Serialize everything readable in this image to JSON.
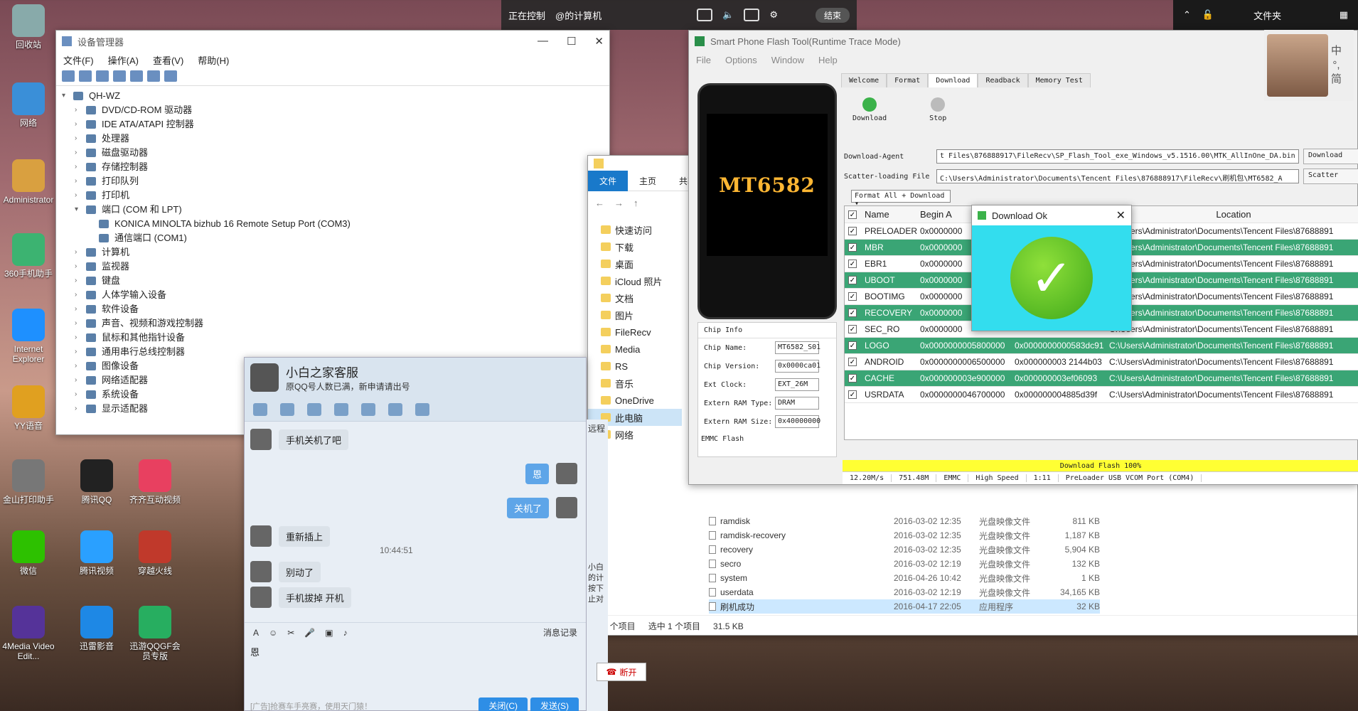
{
  "desktop": {
    "icons": [
      {
        "label": "回收站",
        "color": "#8aa"
      },
      {
        "label": "网络",
        "color": "#3a8fd8"
      },
      {
        "label": "Administrator",
        "color": "#d9a040"
      },
      {
        "label": "360手机助手",
        "color": "#3cb371"
      },
      {
        "label": "Internet Explorer",
        "color": "#1e90ff"
      },
      {
        "label": "YY语音",
        "color": "#e0a020"
      },
      {
        "label": "金山打印助手",
        "color": "#777"
      },
      {
        "label": "微信",
        "color": "#2dc100"
      },
      {
        "label": "4Media Video Edit...",
        "color": "#553399"
      },
      {
        "label": "腾讯QQ",
        "color": "#222"
      },
      {
        "label": "腾讯视频",
        "color": "#2aa0ff"
      },
      {
        "label": "迅雷影音",
        "color": "#1e88e5"
      },
      {
        "label": "齐齐互动视频",
        "color": "#e84060"
      },
      {
        "label": "穿越火线",
        "color": "#c0392b"
      },
      {
        "label": "迅游QQGF会员专版",
        "color": "#27ae60"
      }
    ]
  },
  "remote_bar": {
    "status": "正在控制",
    "target": "@的计算机",
    "end_label": "结束"
  },
  "topright": {
    "folder_label": "文件夹"
  },
  "devmgr": {
    "title": "设备管理器",
    "menu": [
      "文件(F)",
      "操作(A)",
      "查看(V)",
      "帮助(H)"
    ],
    "root": "QH-WZ",
    "nodes": [
      {
        "label": "DVD/CD-ROM 驱动器",
        "indent": 1,
        "expanded": false
      },
      {
        "label": "IDE ATA/ATAPI 控制器",
        "indent": 1,
        "expanded": false
      },
      {
        "label": "处理器",
        "indent": 1,
        "expanded": false
      },
      {
        "label": "磁盘驱动器",
        "indent": 1,
        "expanded": false
      },
      {
        "label": "存储控制器",
        "indent": 1,
        "expanded": false
      },
      {
        "label": "打印队列",
        "indent": 1,
        "expanded": false
      },
      {
        "label": "打印机",
        "indent": 1,
        "expanded": false
      },
      {
        "label": "端口 (COM 和 LPT)",
        "indent": 1,
        "expanded": true
      },
      {
        "label": "KONICA MINOLTA bizhub 16 Remote Setup Port (COM3)",
        "indent": 2,
        "expanded": null
      },
      {
        "label": "通信端口 (COM1)",
        "indent": 2,
        "expanded": null
      },
      {
        "label": "计算机",
        "indent": 1,
        "expanded": false
      },
      {
        "label": "监视器",
        "indent": 1,
        "expanded": false
      },
      {
        "label": "键盘",
        "indent": 1,
        "expanded": false
      },
      {
        "label": "人体学输入设备",
        "indent": 1,
        "expanded": false
      },
      {
        "label": "软件设备",
        "indent": 1,
        "expanded": false
      },
      {
        "label": "声音、视频和游戏控制器",
        "indent": 1,
        "expanded": false
      },
      {
        "label": "鼠标和其他指针设备",
        "indent": 1,
        "expanded": false
      },
      {
        "label": "通用串行总线控制器",
        "indent": 1,
        "expanded": false
      },
      {
        "label": "图像设备",
        "indent": 1,
        "expanded": false
      },
      {
        "label": "网络适配器",
        "indent": 1,
        "expanded": false
      },
      {
        "label": "系统设备",
        "indent": 1,
        "expanded": false
      },
      {
        "label": "显示适配器",
        "indent": 1,
        "expanded": false
      }
    ]
  },
  "qq": {
    "name": "小白之家客服",
    "signature": "原QQ号人数已满，新申请请出号",
    "messages": [
      {
        "dir": "in",
        "text": "手机关机了吧"
      },
      {
        "dir": "out",
        "text": "恩"
      },
      {
        "dir": "out",
        "text": "关机了"
      },
      {
        "dir": "in",
        "text": "重新插上"
      },
      {
        "dir": "in",
        "text": "别动了"
      },
      {
        "dir": "in",
        "text": "手机拔掉 开机"
      }
    ],
    "time": "10:44:51",
    "history_label": "消息记录",
    "input_text": "恩",
    "ad_text": "[广告]抢赛车手亮赛，使用天门猿！",
    "close_label": "关闭(C)",
    "send_label": "发送(S)",
    "side_label": "远程",
    "side_text": "小白的计按下止对",
    "hangup_label": "断开"
  },
  "explorer": {
    "ribbon_tabs": [
      "文件",
      "主页",
      "共享"
    ],
    "sidebar": [
      {
        "label": "快速访问",
        "sel": false
      },
      {
        "label": "下载",
        "sel": false
      },
      {
        "label": "桌面",
        "sel": false
      },
      {
        "label": "iCloud 照片",
        "sel": false
      },
      {
        "label": "文档",
        "sel": false
      },
      {
        "label": "图片",
        "sel": false
      },
      {
        "label": "FileRecv",
        "sel": false
      },
      {
        "label": "Media",
        "sel": false
      },
      {
        "label": "RS",
        "sel": false
      },
      {
        "label": "音乐",
        "sel": false
      },
      {
        "label": "OneDrive",
        "sel": false
      },
      {
        "label": "此电脑",
        "sel": true
      },
      {
        "label": "网络",
        "sel": false
      }
    ],
    "files": [
      {
        "name": "ramdisk",
        "date": "2016-03-02 12:35",
        "type": "光盘映像文件",
        "size": "811 KB",
        "sel": false
      },
      {
        "name": "ramdisk-recovery",
        "date": "2016-03-02 12:35",
        "type": "光盘映像文件",
        "size": "1,187 KB",
        "sel": false
      },
      {
        "name": "recovery",
        "date": "2016-03-02 12:35",
        "type": "光盘映像文件",
        "size": "5,904 KB",
        "sel": false
      },
      {
        "name": "secro",
        "date": "2016-03-02 12:19",
        "type": "光盘映像文件",
        "size": "132 KB",
        "sel": false
      },
      {
        "name": "system",
        "date": "2016-04-26 10:42",
        "type": "光盘映像文件",
        "size": "1 KB",
        "sel": false
      },
      {
        "name": "userdata",
        "date": "2016-03-02 12:19",
        "type": "光盘映像文件",
        "size": "34,165 KB",
        "sel": false
      },
      {
        "name": "刷机成功",
        "date": "2016-04-17 22:05",
        "type": "应用程序",
        "size": "32 KB",
        "sel": true
      }
    ],
    "status_count": "27 个项目",
    "status_sel": "选中 1 个项目",
    "status_size": "31.5 KB"
  },
  "flash": {
    "title": "Smart Phone Flash Tool(Runtime Trace Mode)",
    "menu": [
      "File",
      "Options",
      "Window",
      "Help"
    ],
    "model": "MT6582",
    "tabs": [
      "Welcome",
      "Format",
      "Download",
      "Readback",
      "Memory Test"
    ],
    "active_tab": "Download",
    "download_label": "Download",
    "stop_label": "Stop",
    "da_label": "Download-Agent",
    "da_value": "t Files\\876888917\\FileRecv\\SP_Flash_Tool_exe_Windows_v5.1516.00\\MTK_AllInOne_DA.bin",
    "da_btn": "Download",
    "scatter_label": "Scatter-loading File",
    "scatter_value": "C:\\Users\\Administrator\\Documents\\Tencent Files\\876888917\\FileRecv\\刷机包\\MT6582_A",
    "scatter_btn": "Scatter",
    "format_mode": "Format All + Download",
    "headers": {
      "name": "Name",
      "begin": "Begin A",
      "location": "Location"
    },
    "partitions": [
      {
        "name": "PRELOADER",
        "begin": "0x0000000",
        "end": "",
        "loc": "C:\\Users\\Administrator\\Documents\\Tencent Files\\87688891",
        "green": false
      },
      {
        "name": "MBR",
        "begin": "0x0000000",
        "end": "",
        "loc": "C:\\Users\\Administrator\\Documents\\Tencent Files\\87688891",
        "green": true
      },
      {
        "name": "EBR1",
        "begin": "0x0000000",
        "end": "",
        "loc": "C:\\Users\\Administrator\\Documents\\Tencent Files\\87688891",
        "green": false
      },
      {
        "name": "UBOOT",
        "begin": "0x0000000",
        "end": "",
        "loc": "C:\\Users\\Administrator\\Documents\\Tencent Files\\87688891",
        "green": true
      },
      {
        "name": "BOOTIMG",
        "begin": "0x0000000",
        "end": "",
        "loc": "C:\\Users\\Administrator\\Documents\\Tencent Files\\87688891",
        "green": false
      },
      {
        "name": "RECOVERY",
        "begin": "0x0000000",
        "end": "",
        "loc": "C:\\Users\\Administrator\\Documents\\Tencent Files\\87688891",
        "green": true
      },
      {
        "name": "SEC_RO",
        "begin": "0x0000000",
        "end": "",
        "loc": "C:\\Users\\Administrator\\Documents\\Tencent Files\\87688891",
        "green": false
      },
      {
        "name": "LOGO",
        "begin": "0x0000000005800000",
        "end": "0x0000000000583dc91",
        "loc": "C:\\Users\\Administrator\\Documents\\Tencent Files\\87688891",
        "green": true
      },
      {
        "name": "ANDROID",
        "begin": "0x0000000006500000",
        "end": "0x000000003 2144b03",
        "loc": "C:\\Users\\Administrator\\Documents\\Tencent Files\\87688891",
        "green": false
      },
      {
        "name": "CACHE",
        "begin": "0x000000003e900000",
        "end": "0x000000003ef06093",
        "loc": "C:\\Users\\Administrator\\Documents\\Tencent Files\\87688891",
        "green": true
      },
      {
        "name": "USRDATA",
        "begin": "0x0000000046700000",
        "end": "0x000000004885d39f",
        "loc": "C:\\Users\\Administrator\\Documents\\Tencent Files\\87688891",
        "green": false
      }
    ],
    "chip": {
      "title": "Chip Info",
      "rows": [
        {
          "label": "Chip Name:",
          "value": "MT6582_S01"
        },
        {
          "label": "Chip Version:",
          "value": "0x0000ca01"
        },
        {
          "label": "Ext Clock:",
          "value": "EXT_26M"
        },
        {
          "label": "Extern RAM Type:",
          "value": "DRAM"
        },
        {
          "label": "Extern RAM Size:",
          "value": "0x40000000"
        }
      ],
      "emmc": "EMMC Flash"
    },
    "progress_text": "Download Flash 100%",
    "status": [
      "12.20M/s",
      "751.48M",
      "EMMC",
      "High Speed",
      "1:11",
      "PreLoader USB VCOM Port (COM4)"
    ]
  },
  "dialog": {
    "title": "Download Ok"
  },
  "ime": {
    "chars": [
      "中",
      "°,",
      "简"
    ]
  }
}
